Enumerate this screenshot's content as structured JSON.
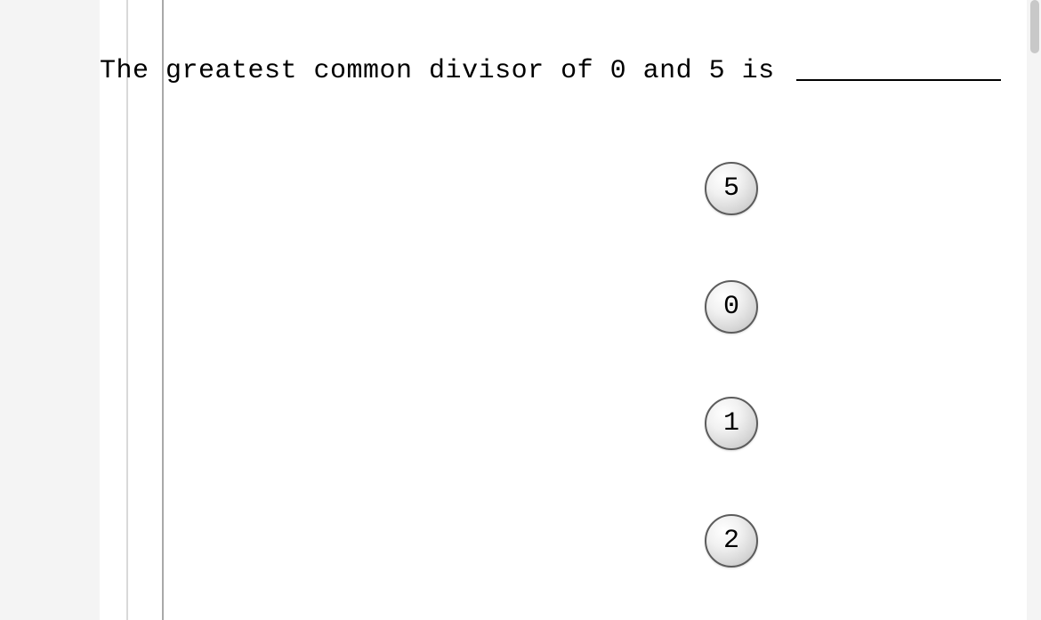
{
  "question": {
    "text": "The greatest common divisor of 0 and 5 is"
  },
  "options": [
    {
      "label": "5"
    },
    {
      "label": "0"
    },
    {
      "label": "1"
    },
    {
      "label": "2"
    }
  ]
}
